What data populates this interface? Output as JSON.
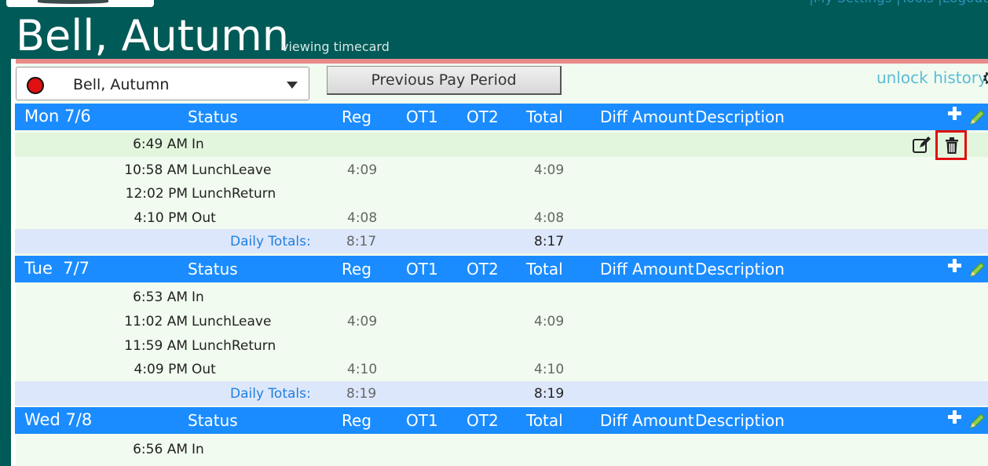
{
  "header": {
    "title": "Bell, Autumn",
    "subtitle": "viewing timecard",
    "top_links": "|My Settings |Tools |Logout"
  },
  "toolbar": {
    "employee_name": "Bell, Autumn",
    "employee_status_color": "#e01010",
    "prev_period_label": "Previous Pay Period",
    "unlock_history_label": "unlock history"
  },
  "columns": {
    "status": "Status",
    "reg": "Reg",
    "ot1": "OT1",
    "ot2": "OT2",
    "total": "Total",
    "diff": "Diff",
    "amount": "Amount",
    "description": "Description"
  },
  "days": [
    {
      "label": "Mon 7/6",
      "punches": [
        {
          "time": "6:49 AM",
          "status": "In",
          "reg": "",
          "total": ""
        },
        {
          "time": "10:58 AM",
          "status": "LunchLeave",
          "reg": "4:09",
          "total": "4:09"
        },
        {
          "time": "12:02 PM",
          "status": "LunchReturn",
          "reg": "",
          "total": ""
        },
        {
          "time": "4:10 PM",
          "status": "Out",
          "reg": "4:08",
          "total": "4:08"
        }
      ],
      "totals": {
        "label": "Daily Totals:",
        "reg": "8:17",
        "total": "8:17"
      }
    },
    {
      "label": "Tue  7/7",
      "punches": [
        {
          "time": "6:53 AM",
          "status": "In",
          "reg": "",
          "total": ""
        },
        {
          "time": "11:02 AM",
          "status": "LunchLeave",
          "reg": "4:09",
          "total": "4:09"
        },
        {
          "time": "11:59 AM",
          "status": "LunchReturn",
          "reg": "",
          "total": ""
        },
        {
          "time": "4:09 PM",
          "status": "Out",
          "reg": "4:10",
          "total": "4:10"
        }
      ],
      "totals": {
        "label": "Daily Totals:",
        "reg": "8:19",
        "total": "8:19"
      }
    },
    {
      "label": "Wed 7/8",
      "punches": [
        {
          "time": "6:56 AM",
          "status": "In",
          "reg": "",
          "total": ""
        }
      ]
    }
  ],
  "colors": {
    "page_bg": "#005a57",
    "day_header": "#1a8cff",
    "totals_bg": "#dde7fb",
    "highlight_row": "#e2f6de",
    "accent_red": "#e01010",
    "link": "#5bbcd6"
  }
}
